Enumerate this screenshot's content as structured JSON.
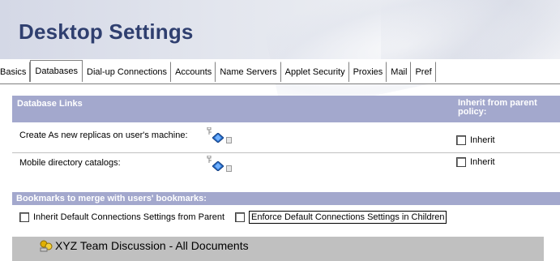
{
  "header": {
    "title": "Desktop Settings"
  },
  "tabs": [
    {
      "label": "Basics"
    },
    {
      "label": "Databases"
    },
    {
      "label": "Dial-up Connections"
    },
    {
      "label": "Accounts"
    },
    {
      "label": "Name Servers"
    },
    {
      "label": "Applet Security"
    },
    {
      "label": "Proxies"
    },
    {
      "label": "Mail"
    },
    {
      "label": "Pref"
    }
  ],
  "active_tab": "Databases",
  "database_links": {
    "header": "Database Links",
    "inherit_header": "Inherit from parent policy:",
    "rows": [
      {
        "label": "Create As new replicas on user's machine:",
        "inherit_label": "Inherit",
        "inherit_checked": false
      },
      {
        "label": "Mobile directory catalogs:",
        "inherit_label": "Inherit",
        "inherit_checked": false
      }
    ]
  },
  "bookmarks": {
    "header": "Bookmarks to merge with users' bookmarks:",
    "option_inherit": "Inherit Default Connections Settings from Parent",
    "option_inherit_checked": false,
    "option_enforce": "Enforce Default Connections Settings in Children",
    "option_enforce_checked": false,
    "items": [
      {
        "label": "XYZ Team Discussion - All Documents"
      }
    ]
  },
  "colors": {
    "title": "#2f3f6f",
    "section_header_bg": "#a3a8cd",
    "section_header_text": "#ffffff",
    "list_bg": "#c0c0c0"
  },
  "icons": [
    "key-icon",
    "diamond-icon",
    "cursor-icon",
    "discussion-db-icon"
  ]
}
